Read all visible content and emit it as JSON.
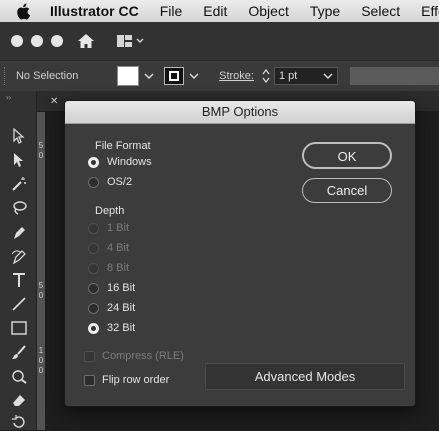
{
  "menubar": {
    "app_name": "Illustrator CC",
    "items": [
      "File",
      "Edit",
      "Object",
      "Type",
      "Select",
      "Effe"
    ]
  },
  "controlbar": {
    "selection_text": "No Selection",
    "stroke_label": "Stroke:",
    "stroke_value": "1 pt"
  },
  "rulers": {
    "vertical_ticks": [
      "5",
      "0",
      "5",
      "0",
      "1",
      "0",
      "0"
    ]
  },
  "dialog": {
    "title": "BMP Options",
    "file_format_label": "File Format",
    "formats": [
      {
        "label": "Windows",
        "selected": true
      },
      {
        "label": "OS/2",
        "selected": false
      }
    ],
    "depth_label": "Depth",
    "depths": [
      {
        "label": "1 Bit",
        "selected": false,
        "enabled": false
      },
      {
        "label": "4 Bit",
        "selected": false,
        "enabled": false
      },
      {
        "label": "8 Bit",
        "selected": false,
        "enabled": false
      },
      {
        "label": "16 Bit",
        "selected": false,
        "enabled": true
      },
      {
        "label": "24 Bit",
        "selected": false,
        "enabled": true
      },
      {
        "label": "32 Bit",
        "selected": true,
        "enabled": true
      }
    ],
    "compress_label": "Compress (RLE)",
    "compress_enabled": false,
    "flip_label": "Flip row order",
    "ok_label": "OK",
    "cancel_label": "Cancel",
    "advanced_label": "Advanced Modes"
  },
  "icons": {
    "apple": "apple-icon",
    "home": "home-icon",
    "workspace": "workspace-layout-icon"
  },
  "colors": {
    "app_bg": "#323232",
    "dialog_bg": "#3c3c3c",
    "title_bar": "#d9d9d9"
  }
}
